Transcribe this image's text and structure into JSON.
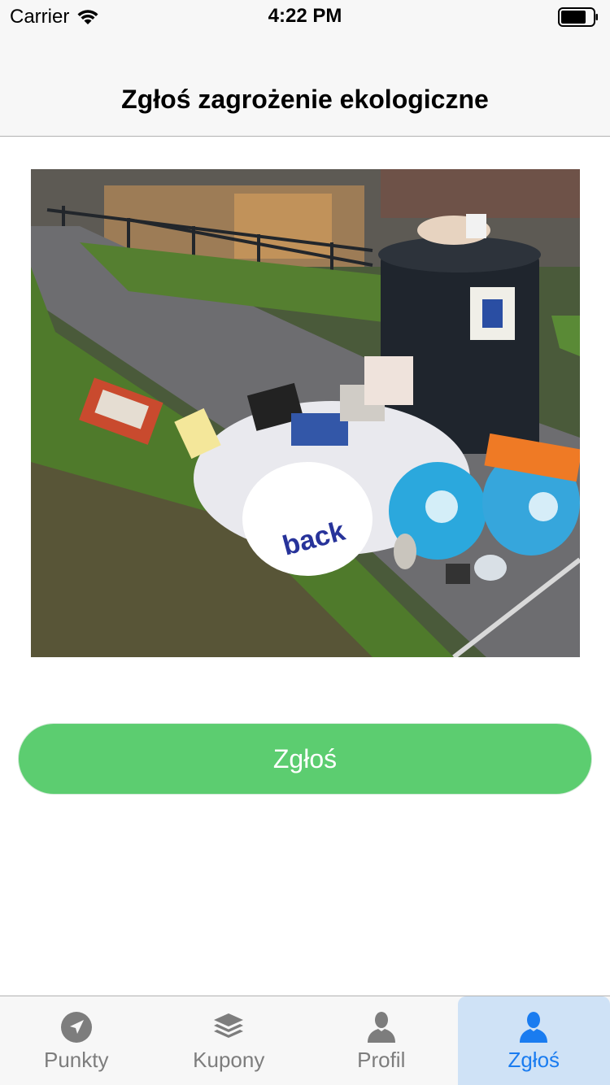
{
  "status_bar": {
    "carrier": "Carrier",
    "time": "4:22 PM",
    "icons": [
      "wifi-icon",
      "battery-icon"
    ]
  },
  "nav": {
    "title": "Zgłoś zagrożenie ekologiczne"
  },
  "photo": {
    "description_icon": "reported-photo"
  },
  "actions": {
    "report_label": "Zgłoś",
    "report_color": "#5ccd70"
  },
  "tab_bar": {
    "active_color": "#1a7cf0",
    "inactive_color": "#7d7d7d",
    "active_background": "#cfe2f6",
    "items": [
      {
        "label": "Punkty",
        "icon": "location-arrow-icon",
        "active": false
      },
      {
        "label": "Kupony",
        "icon": "layers-icon",
        "active": false
      },
      {
        "label": "Profil",
        "icon": "person-icon",
        "active": false
      },
      {
        "label": "Zgłoś",
        "icon": "person-icon",
        "active": true
      }
    ]
  }
}
